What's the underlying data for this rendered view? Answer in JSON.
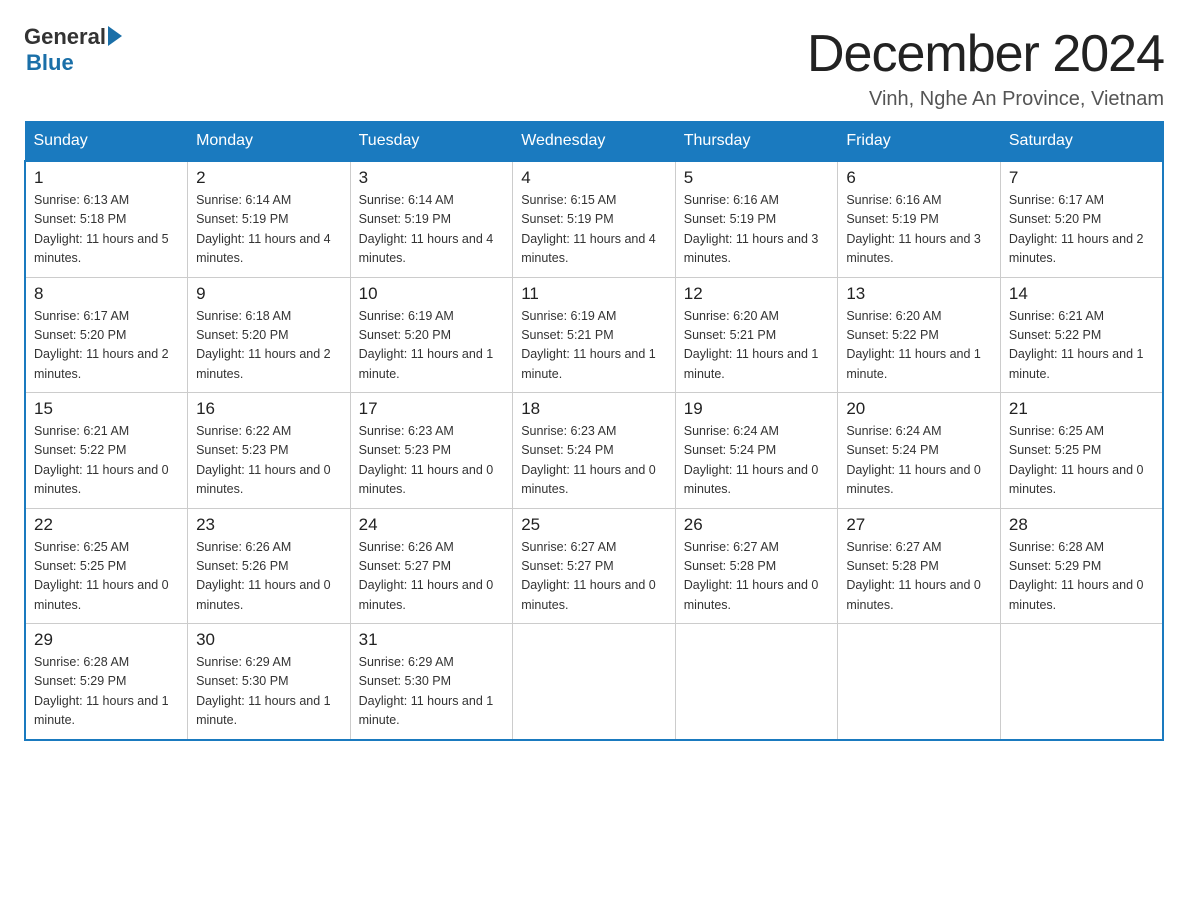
{
  "header": {
    "logo_general": "General",
    "logo_blue": "Blue",
    "title": "December 2024",
    "subtitle": "Vinh, Nghe An Province, Vietnam"
  },
  "weekdays": [
    "Sunday",
    "Monday",
    "Tuesday",
    "Wednesday",
    "Thursday",
    "Friday",
    "Saturday"
  ],
  "weeks": [
    [
      {
        "day": "1",
        "sunrise": "6:13 AM",
        "sunset": "5:18 PM",
        "daylight": "11 hours and 5 minutes."
      },
      {
        "day": "2",
        "sunrise": "6:14 AM",
        "sunset": "5:19 PM",
        "daylight": "11 hours and 4 minutes."
      },
      {
        "day": "3",
        "sunrise": "6:14 AM",
        "sunset": "5:19 PM",
        "daylight": "11 hours and 4 minutes."
      },
      {
        "day": "4",
        "sunrise": "6:15 AM",
        "sunset": "5:19 PM",
        "daylight": "11 hours and 4 minutes."
      },
      {
        "day": "5",
        "sunrise": "6:16 AM",
        "sunset": "5:19 PM",
        "daylight": "11 hours and 3 minutes."
      },
      {
        "day": "6",
        "sunrise": "6:16 AM",
        "sunset": "5:19 PM",
        "daylight": "11 hours and 3 minutes."
      },
      {
        "day": "7",
        "sunrise": "6:17 AM",
        "sunset": "5:20 PM",
        "daylight": "11 hours and 2 minutes."
      }
    ],
    [
      {
        "day": "8",
        "sunrise": "6:17 AM",
        "sunset": "5:20 PM",
        "daylight": "11 hours and 2 minutes."
      },
      {
        "day": "9",
        "sunrise": "6:18 AM",
        "sunset": "5:20 PM",
        "daylight": "11 hours and 2 minutes."
      },
      {
        "day": "10",
        "sunrise": "6:19 AM",
        "sunset": "5:20 PM",
        "daylight": "11 hours and 1 minute."
      },
      {
        "day": "11",
        "sunrise": "6:19 AM",
        "sunset": "5:21 PM",
        "daylight": "11 hours and 1 minute."
      },
      {
        "day": "12",
        "sunrise": "6:20 AM",
        "sunset": "5:21 PM",
        "daylight": "11 hours and 1 minute."
      },
      {
        "day": "13",
        "sunrise": "6:20 AM",
        "sunset": "5:22 PM",
        "daylight": "11 hours and 1 minute."
      },
      {
        "day": "14",
        "sunrise": "6:21 AM",
        "sunset": "5:22 PM",
        "daylight": "11 hours and 1 minute."
      }
    ],
    [
      {
        "day": "15",
        "sunrise": "6:21 AM",
        "sunset": "5:22 PM",
        "daylight": "11 hours and 0 minutes."
      },
      {
        "day": "16",
        "sunrise": "6:22 AM",
        "sunset": "5:23 PM",
        "daylight": "11 hours and 0 minutes."
      },
      {
        "day": "17",
        "sunrise": "6:23 AM",
        "sunset": "5:23 PM",
        "daylight": "11 hours and 0 minutes."
      },
      {
        "day": "18",
        "sunrise": "6:23 AM",
        "sunset": "5:24 PM",
        "daylight": "11 hours and 0 minutes."
      },
      {
        "day": "19",
        "sunrise": "6:24 AM",
        "sunset": "5:24 PM",
        "daylight": "11 hours and 0 minutes."
      },
      {
        "day": "20",
        "sunrise": "6:24 AM",
        "sunset": "5:24 PM",
        "daylight": "11 hours and 0 minutes."
      },
      {
        "day": "21",
        "sunrise": "6:25 AM",
        "sunset": "5:25 PM",
        "daylight": "11 hours and 0 minutes."
      }
    ],
    [
      {
        "day": "22",
        "sunrise": "6:25 AM",
        "sunset": "5:25 PM",
        "daylight": "11 hours and 0 minutes."
      },
      {
        "day": "23",
        "sunrise": "6:26 AM",
        "sunset": "5:26 PM",
        "daylight": "11 hours and 0 minutes."
      },
      {
        "day": "24",
        "sunrise": "6:26 AM",
        "sunset": "5:27 PM",
        "daylight": "11 hours and 0 minutes."
      },
      {
        "day": "25",
        "sunrise": "6:27 AM",
        "sunset": "5:27 PM",
        "daylight": "11 hours and 0 minutes."
      },
      {
        "day": "26",
        "sunrise": "6:27 AM",
        "sunset": "5:28 PM",
        "daylight": "11 hours and 0 minutes."
      },
      {
        "day": "27",
        "sunrise": "6:27 AM",
        "sunset": "5:28 PM",
        "daylight": "11 hours and 0 minutes."
      },
      {
        "day": "28",
        "sunrise": "6:28 AM",
        "sunset": "5:29 PM",
        "daylight": "11 hours and 0 minutes."
      }
    ],
    [
      {
        "day": "29",
        "sunrise": "6:28 AM",
        "sunset": "5:29 PM",
        "daylight": "11 hours and 1 minute."
      },
      {
        "day": "30",
        "sunrise": "6:29 AM",
        "sunset": "5:30 PM",
        "daylight": "11 hours and 1 minute."
      },
      {
        "day": "31",
        "sunrise": "6:29 AM",
        "sunset": "5:30 PM",
        "daylight": "11 hours and 1 minute."
      },
      null,
      null,
      null,
      null
    ]
  ]
}
